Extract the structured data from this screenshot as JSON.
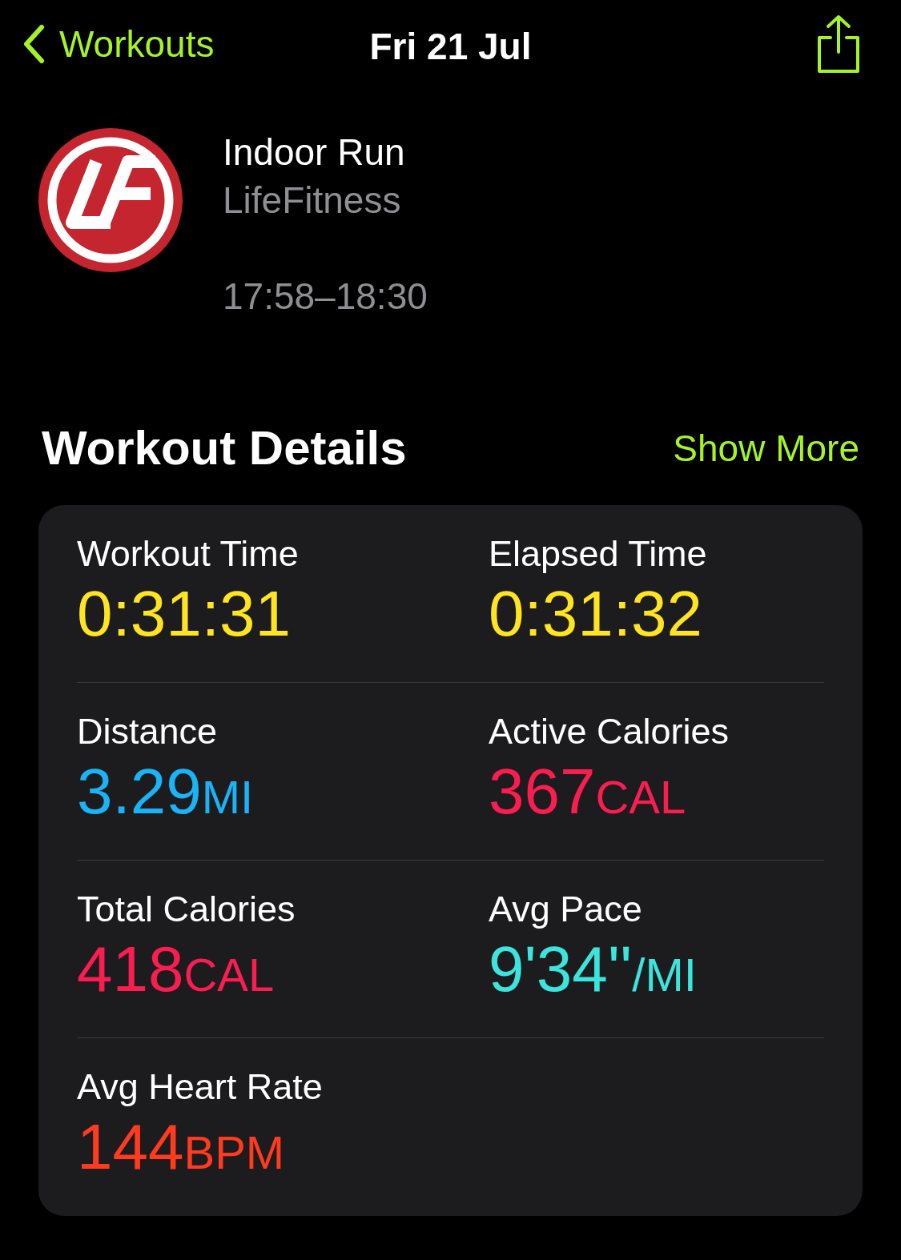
{
  "nav": {
    "back_label": "Workouts",
    "title": "Fri 21 Jul"
  },
  "workout": {
    "title": "Indoor Run",
    "source": "LifeFitness",
    "time_range": "17:58–18:30"
  },
  "section": {
    "title": "Workout Details",
    "action": "Show More"
  },
  "metrics": [
    [
      {
        "label": "Workout Time",
        "value": "0:31:31",
        "color": "#ffe41f"
      },
      {
        "label": "Elapsed Time",
        "value": "0:31:32",
        "color": "#ffe41f"
      }
    ],
    [
      {
        "label": "Distance",
        "value": "3.29",
        "unit": "MI",
        "color": "#1ab3f5"
      },
      {
        "label": "Active Calories",
        "value": "367",
        "unit": "CAL",
        "color": "#fb1d50"
      }
    ],
    [
      {
        "label": "Total Calories",
        "value": "418",
        "unit": "CAL",
        "color": "#fb1d50"
      },
      {
        "label": "Avg Pace",
        "value": "9'34''",
        "unit": "/MI",
        "color": "#3be5dd"
      }
    ],
    [
      {
        "label": "Avg Heart Rate",
        "value": "144",
        "unit": "BPM",
        "color": "#ff3a1f"
      }
    ]
  ]
}
